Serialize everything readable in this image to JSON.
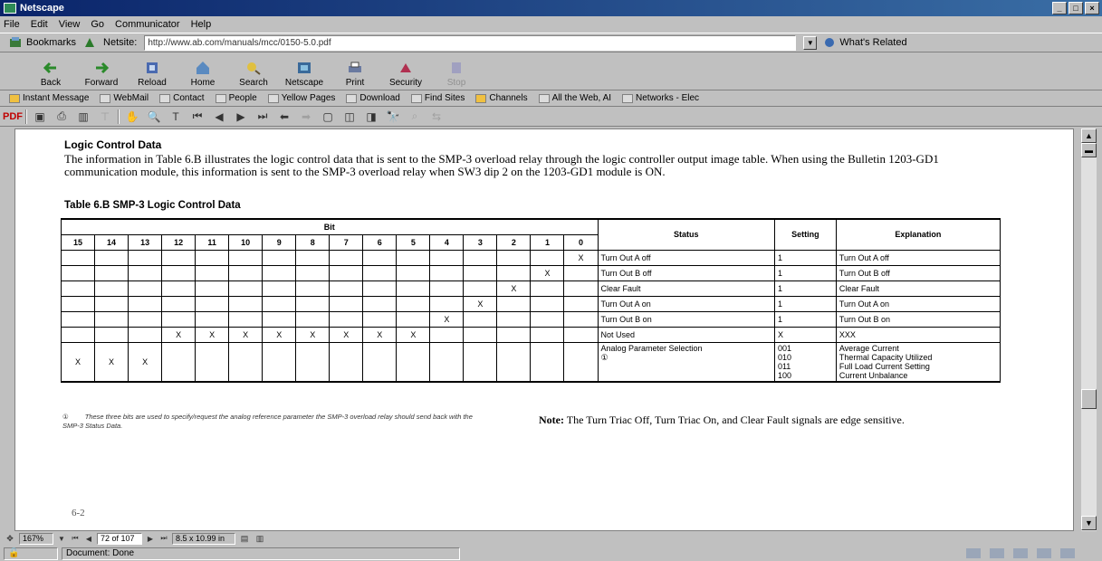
{
  "window": {
    "title": "Netscape",
    "controls": [
      "_",
      "□",
      "×"
    ]
  },
  "menubar": [
    "File",
    "Edit",
    "View",
    "Go",
    "Communicator",
    "Help"
  ],
  "location": {
    "bookmarks_label": "Bookmarks",
    "netsite_label": "Netsite:",
    "url": "http://www.ab.com/manuals/mcc/0150-5.0.pdf",
    "whats_related": "What's Related"
  },
  "nav_buttons": [
    {
      "label": "Back",
      "icon": "back-arrow-icon"
    },
    {
      "label": "Forward",
      "icon": "forward-arrow-icon"
    },
    {
      "label": "Reload",
      "icon": "reload-icon"
    },
    {
      "label": "Home",
      "icon": "home-icon"
    },
    {
      "label": "Search",
      "icon": "search-icon"
    },
    {
      "label": "Netscape",
      "icon": "netscape-icon"
    },
    {
      "label": "Print",
      "icon": "print-icon"
    },
    {
      "label": "Security",
      "icon": "security-icon"
    },
    {
      "label": "Stop",
      "icon": "stop-icon"
    }
  ],
  "personal_toolbar": [
    "Instant Message",
    "WebMail",
    "Contact",
    "People",
    "Yellow Pages",
    "Download",
    "Find Sites",
    "Channels",
    "All the Web, AI",
    "Networks - Elec"
  ],
  "document": {
    "heading": "Logic Control Data",
    "paragraph": "The information in Table 6.B illustrates the logic control data that is sent to the SMP-3 overload relay through the logic controller output image table.  When using the Bulletin 1203-GD1 communication module, this information is sent to the SMP-3 overload relay when SW3 dip 2 on the 1203-GD1 module is ON.",
    "table_caption": "Table 6.B SMP-3 Logic Control Data",
    "table": {
      "bit_header": "Bit",
      "bits": [
        "15",
        "14",
        "13",
        "12",
        "11",
        "10",
        "9",
        "8",
        "7",
        "6",
        "5",
        "4",
        "3",
        "2",
        "1",
        "0"
      ],
      "status_header": "Status",
      "setting_header": "Setting",
      "explanation_header": "Explanation",
      "rows": [
        {
          "marks": [
            "",
            "",
            "",
            "",
            "",
            "",
            "",
            "",
            "",
            "",
            "",
            "",
            "",
            "",
            "",
            "X"
          ],
          "status": "Turn Out A off",
          "setting": "1",
          "explanation": "Turn Out A off"
        },
        {
          "marks": [
            "",
            "",
            "",
            "",
            "",
            "",
            "",
            "",
            "",
            "",
            "",
            "",
            "",
            "",
            "X",
            ""
          ],
          "status": "Turn Out B off",
          "setting": "1",
          "explanation": "Turn Out B off"
        },
        {
          "marks": [
            "",
            "",
            "",
            "",
            "",
            "",
            "",
            "",
            "",
            "",
            "",
            "",
            "",
            "X",
            "",
            ""
          ],
          "status": "Clear Fault",
          "setting": "1",
          "explanation": "Clear Fault"
        },
        {
          "marks": [
            "",
            "",
            "",
            "",
            "",
            "",
            "",
            "",
            "",
            "",
            "",
            "",
            "X",
            "",
            "",
            ""
          ],
          "status": "Turn Out A on",
          "setting": "1",
          "explanation": "Turn Out A on"
        },
        {
          "marks": [
            "",
            "",
            "",
            "",
            "",
            "",
            "",
            "",
            "",
            "",
            "",
            "X",
            "",
            "",
            "",
            ""
          ],
          "status": "Turn Out B on",
          "setting": "1",
          "explanation": "Turn Out B on"
        },
        {
          "marks": [
            "",
            "",
            "",
            "X",
            "X",
            "X",
            "X",
            "X",
            "X",
            "X",
            "X",
            "",
            "",
            "",
            "",
            ""
          ],
          "status": "Not Used",
          "setting": "X",
          "explanation": "XXX"
        },
        {
          "marks": [
            "X",
            "X",
            "X",
            "",
            "",
            "",
            "",
            "",
            "",
            "",
            "",
            "",
            "",
            "",
            "",
            ""
          ],
          "status": "Analog Parameter Selection",
          "status_note": "①",
          "setting": "001\n010\n011\n100",
          "explanation": "Average Current\nThermal Capacity Utilized\nFull Load Current Setting\nCurrent Unbalance"
        }
      ]
    },
    "footnote_number": "①",
    "footnote": "These three bits are used to specify/request the analog reference parameter the SMP-3 overload relay should send back with the SMP-3 Status Data.",
    "note_label": "Note:",
    "note_text": "The Turn Triac Off, Turn Triac On, and Clear Fault signals are edge sensitive.",
    "page_number": "6-2"
  },
  "acrobat_status": {
    "zoom": "167%",
    "page": "72 of 107",
    "size": "8.5 x 10.99 in"
  },
  "statusbar": {
    "text": "Document: Done"
  }
}
